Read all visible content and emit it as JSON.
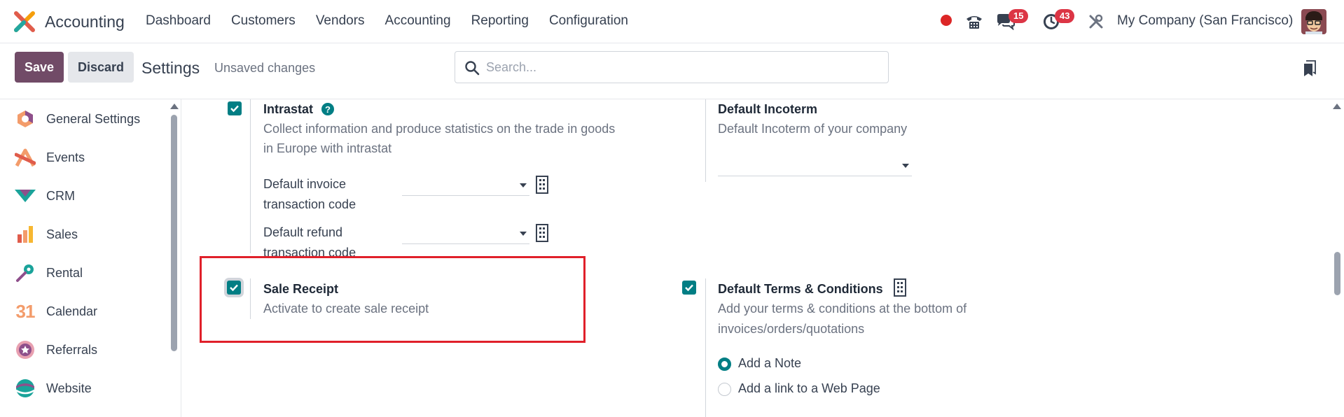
{
  "app": {
    "name": "Accounting"
  },
  "menu": [
    "Dashboard",
    "Customers",
    "Vendors",
    "Accounting",
    "Reporting",
    "Configuration"
  ],
  "navbar": {
    "messages_count": "15",
    "activities_count": "43",
    "company": "My Company (San Francisco)"
  },
  "control": {
    "save_label": "Save",
    "discard_label": "Discard",
    "title": "Settings",
    "unsaved": "Unsaved changes",
    "search_placeholder": "Search..."
  },
  "sidebar": {
    "items": [
      {
        "label": "General Settings",
        "icon": "general-settings-icon"
      },
      {
        "label": "Events",
        "icon": "events-icon"
      },
      {
        "label": "CRM",
        "icon": "crm-icon"
      },
      {
        "label": "Sales",
        "icon": "sales-icon"
      },
      {
        "label": "Rental",
        "icon": "rental-icon"
      },
      {
        "label": "Calendar",
        "icon": "calendar-icon",
        "icon_text": "31"
      },
      {
        "label": "Referrals",
        "icon": "referrals-icon"
      },
      {
        "label": "Website",
        "icon": "website-icon"
      }
    ]
  },
  "settings": {
    "intrastat": {
      "title": "Intrastat",
      "help": "?",
      "desc_line1": "Collect information and produce statistics on the trade in goods",
      "desc_line2": "in Europe with intrastat",
      "invoice_code_line1": "Default invoice",
      "invoice_code_line2": "transaction code",
      "refund_code_line1": "Default refund",
      "refund_code_line2": "transaction code",
      "checked": true
    },
    "incoterm": {
      "title": "Default Incoterm",
      "desc": "Default Incoterm of your company"
    },
    "sale_receipt": {
      "title": "Sale Receipt",
      "desc": "Activate to create sale receipt",
      "checked": true
    },
    "terms": {
      "title": "Default Terms & Conditions",
      "desc_line1": "Add your terms & conditions at the bottom of",
      "desc_line2": "invoices/orders/quotations",
      "checked": true,
      "options": [
        "Add a Note",
        "Add a link to a Web Page"
      ],
      "selected": "Add a Note"
    }
  },
  "colors": {
    "brand": "#714b67",
    "accent": "#017e84",
    "highlight": "#e0202a",
    "badge": "#dc3545"
  }
}
